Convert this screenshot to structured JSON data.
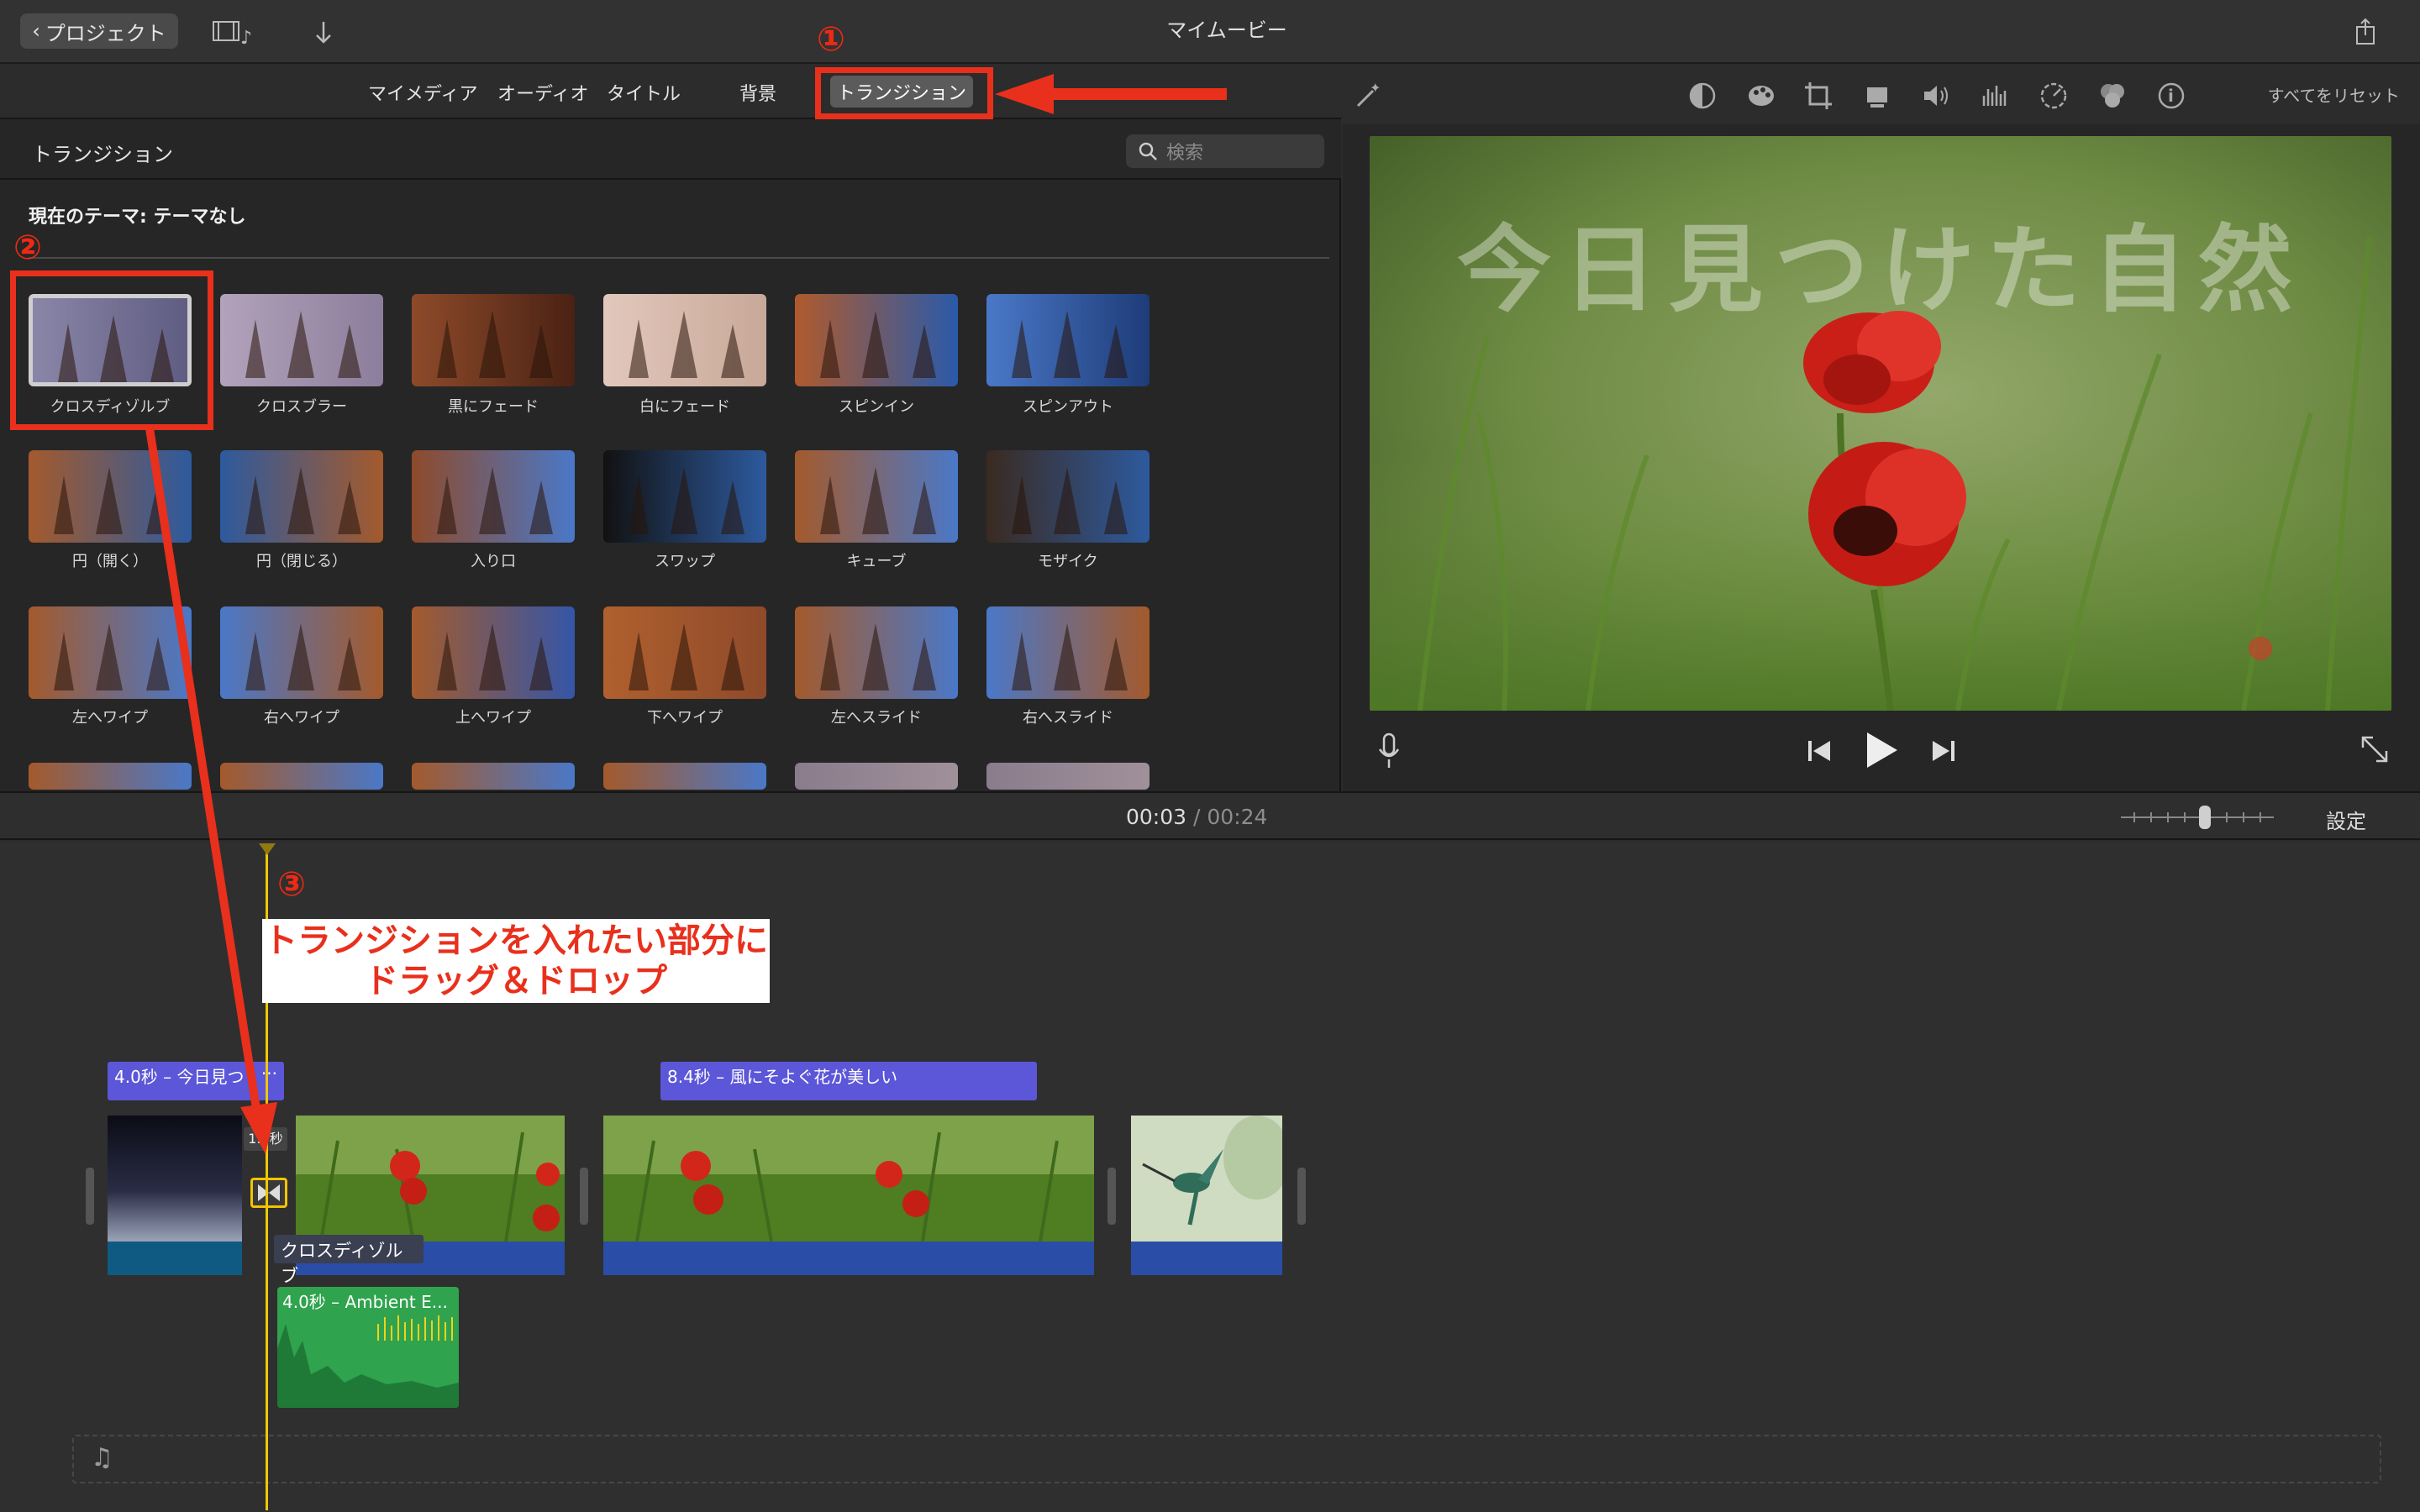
{
  "titlebar": {
    "back_label": "プロジェクト",
    "title": "マイムービー"
  },
  "media_tabs": {
    "my_media": "マイメディア",
    "audio": "オーディオ",
    "titles": "タイトル",
    "backgrounds": "背景",
    "transitions": "トランジション"
  },
  "browser": {
    "title": "トランジション",
    "search_placeholder": "検索",
    "theme_label": "現在のテーマ: テーマなし"
  },
  "transitions": [
    "クロスディゾルブ",
    "クロスブラー",
    "黒にフェード",
    "白にフェード",
    "スピンイン",
    "スピンアウト",
    "円（開く）",
    "円（閉じる）",
    "入り口",
    "スワップ",
    "キューブ",
    "モザイク",
    "左へワイプ",
    "右へワイプ",
    "上へワイプ",
    "下へワイプ",
    "左へスライド",
    "右へスライド"
  ],
  "viewer": {
    "reset_all": "すべてをリセット",
    "preview_title": "今日見つけた自然"
  },
  "timeline": {
    "current_time": "00:03",
    "separator": "/",
    "total_time": "00:24",
    "settings": "設定",
    "title_clip_1": "4.0秒 – 今日見つ",
    "title_clip_1_more": "···",
    "title_clip_2": "8.4秒 – 風にそよぐ花が美しい",
    "transition_label": "クロスディゾルブ",
    "audio_clip": "4.0秒 – Ambient E...",
    "transition_duration_mark": "1.0秒"
  },
  "annotations": {
    "step1": "①",
    "step2": "②",
    "step3": "③",
    "callout_line1": "トランジションを入れたい部分に",
    "callout_line2": "ドラッグ＆ドロップ",
    "accent_color": "#e8301c"
  }
}
